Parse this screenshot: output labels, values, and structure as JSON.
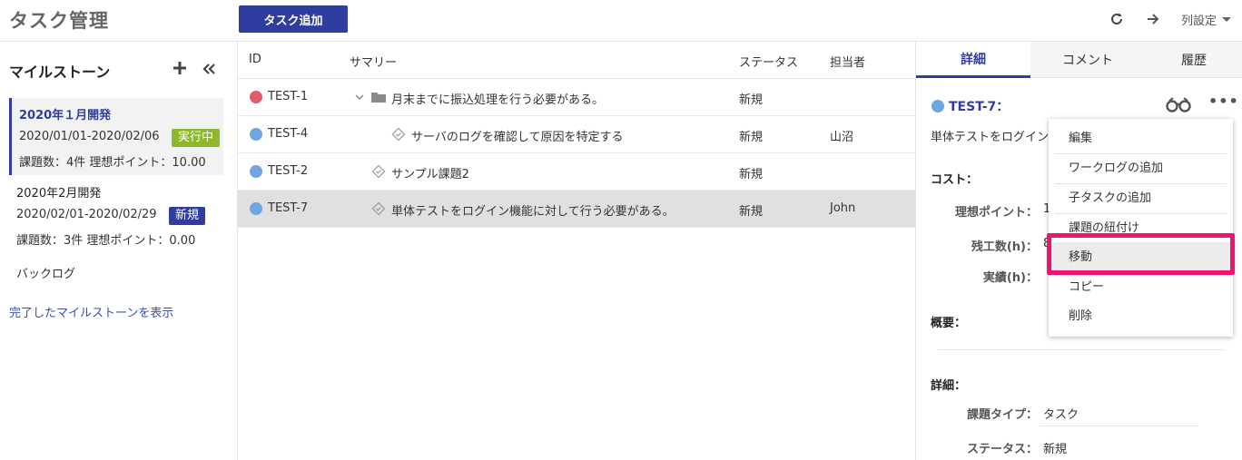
{
  "header": {
    "app_title": "タスク管理",
    "add_task_label": "タスク追加",
    "column_settings_label": "列設定",
    "icons": {
      "refresh": "refresh-icon",
      "forward": "arrow-right-icon",
      "caret": "caret-down-icon"
    }
  },
  "sidebar": {
    "title": "マイルストーン",
    "milestones": [
      {
        "name": "2020年１月開発",
        "dates": "2020/01/01-2020/02/06",
        "badge": "実行中",
        "badge_color": "#8cb82a",
        "summary": "課題数：4件 理想ポイント：10.00",
        "active": true
      },
      {
        "name": "2020年2月開発",
        "dates": "2020/02/01-2020/02/29",
        "badge": "新規",
        "badge_color": "#2f3d9e",
        "summary": "課題数：3件 理想ポイント：0.00",
        "active": false
      }
    ],
    "backlog_label": "バックログ",
    "show_completed_label": "完了したマイルストーンを表示"
  },
  "table": {
    "headers": {
      "id": "ID",
      "summary": "サマリー",
      "status": "ステータス",
      "assignee": "担当者"
    },
    "rows": [
      {
        "id": "TEST-1",
        "summary": "月末までに振込処理を行う必要がある。",
        "status": "新規",
        "assignee": "",
        "dot_color": "#e05c6a",
        "icon": "folder-icon"
      },
      {
        "id": "TEST-4",
        "summary": "サーバのログを確認して原因を特定する",
        "status": "新規",
        "assignee": "山沼",
        "dot_color": "#6fa5e0",
        "icon": "task-diamond-icon"
      },
      {
        "id": "TEST-2",
        "summary": "サンプル課題2",
        "status": "新規",
        "assignee": "",
        "dot_color": "#6fa5e0",
        "icon": "task-diamond-icon"
      },
      {
        "id": "TEST-7",
        "summary": "単体テストをログイン機能に対して行う必要がある。",
        "status": "新規",
        "assignee": "John",
        "dot_color": "#6fa5e0",
        "icon": "task-diamond-icon",
        "selected": true
      }
    ]
  },
  "panel": {
    "tabs": [
      "詳細",
      "コメント",
      "履歴"
    ],
    "key": "TEST-7：",
    "summary": "単体テストをログイン",
    "cost_heading": "コスト：",
    "ideal_points_label": "理想ポイント：",
    "ideal_points_value": "1",
    "remaining_label": "残工数(h)：",
    "remaining_value": "8",
    "actual_label": "実績(h)：",
    "overview_heading": "概要：",
    "details_heading": "詳細：",
    "issue_type_label": "課題タイプ：",
    "issue_type_value": "タスク",
    "status_label": "ステータス：",
    "status_value": "新規"
  },
  "menu": {
    "items": [
      "編集",
      "ワークログの追加",
      "子タスクの追加",
      "課題の紐付け",
      "移動",
      "コピー",
      "削除"
    ],
    "highlighted": "移動",
    "highlight_color": "#f0136f"
  }
}
